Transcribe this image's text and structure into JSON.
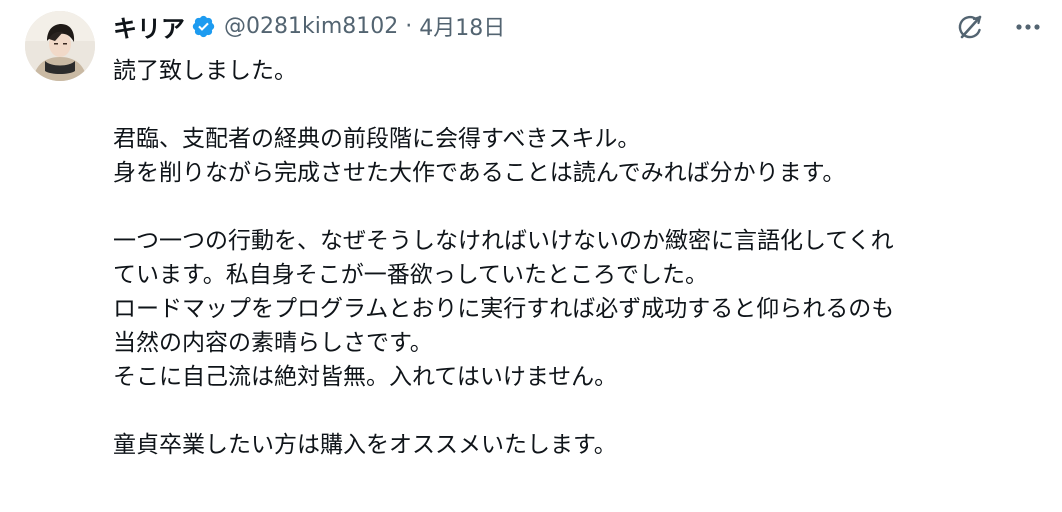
{
  "author": {
    "display_name": "キリア",
    "handle": "@0281kim8102",
    "separator": "·",
    "date": "4月18日",
    "verified": true,
    "avatar_icon": "user-avatar",
    "verified_color": "#1d9bf0"
  },
  "actions": {
    "grok_icon": "grok-slash-icon",
    "more_icon": "more-dots-icon"
  },
  "tweet": {
    "lines": [
      "読了致しました。",
      "",
      "君臨、支配者の経典の前段階に会得すべきスキル。",
      "身を削りながら完成させた大作であることは読んでみれば分かります。",
      "",
      "一つ一つの行動を、なぜそうしなければいけないのか緻密に言語化してくれ",
      "ています。私自身そこが一番欲っしていたところでした。",
      "ロードマップをプログラムとおりに実行すれば必ず成功すると仰られるのも",
      "当然の内容の素晴らしさです。",
      "そこに自己流は絶対皆無。入れてはいけません。",
      "",
      "童貞卒業したい方は購入をオススメいたします。"
    ]
  }
}
